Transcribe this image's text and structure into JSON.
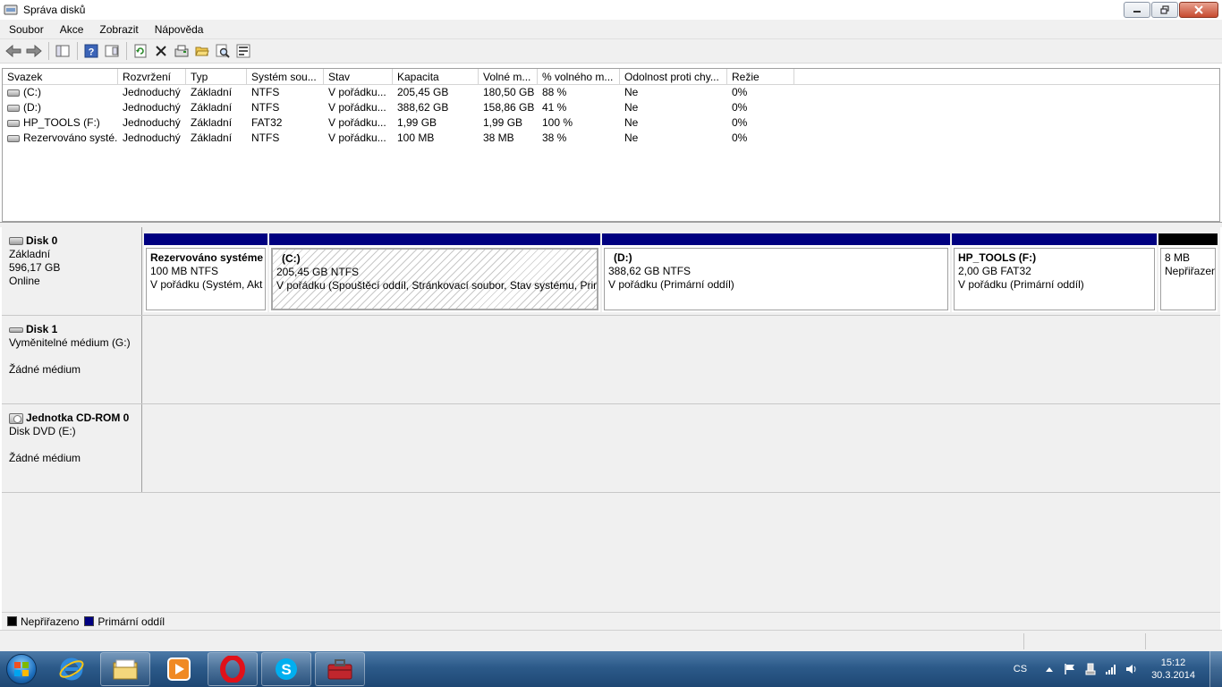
{
  "window": {
    "title": "Správa disků"
  },
  "menu": {
    "items": [
      "Soubor",
      "Akce",
      "Zobrazit",
      "Nápověda"
    ]
  },
  "toolbar": {
    "icons": [
      "back-icon",
      "forward-icon",
      "console-tree-icon",
      "help-icon",
      "properties-icon",
      "refresh-icon",
      "delete-icon",
      "rescan-icon",
      "open-icon",
      "search-icon",
      "settings-icon"
    ]
  },
  "volumes": {
    "columns": [
      "Svazek",
      "Rozvržení",
      "Typ",
      "Systém sou...",
      "Stav",
      "Kapacita",
      "Volné m...",
      "% volného m...",
      "Odolnost proti chy...",
      "Režie"
    ],
    "rows": [
      [
        "(C:)",
        "Jednoduchý",
        "Základní",
        "NTFS",
        "V pořádku...",
        "205,45 GB",
        "180,50 GB",
        "88 %",
        "Ne",
        "0%"
      ],
      [
        "(D:)",
        "Jednoduchý",
        "Základní",
        "NTFS",
        "V pořádku...",
        "388,62 GB",
        "158,86 GB",
        "41 %",
        "Ne",
        "0%"
      ],
      [
        "HP_TOOLS (F:)",
        "Jednoduchý",
        "Základní",
        "FAT32",
        "V pořádku...",
        "1,99 GB",
        "1,99 GB",
        "100 %",
        "Ne",
        "0%"
      ],
      [
        "Rezervováno systé...",
        "Jednoduchý",
        "Základní",
        "NTFS",
        "V pořádku...",
        "100 MB",
        "38 MB",
        "38 %",
        "Ne",
        "0%"
      ]
    ]
  },
  "disks": [
    {
      "name": "Disk 0",
      "type": "Základní",
      "size": "596,17 GB",
      "status": "Online",
      "partitions": [
        {
          "name": "Rezervováno systéme",
          "size": "100 MB NTFS",
          "status": "V pořádku (Systém, Akt"
        },
        {
          "name": "(C:)",
          "size": "205,45 GB NTFS",
          "status": "V pořádku (Spouštěcí oddíl, Stránkovací soubor, Stav systému, Prim"
        },
        {
          "name": "(D:)",
          "size": "388,62 GB NTFS",
          "status": "V pořádku (Primární oddíl)"
        },
        {
          "name": "HP_TOOLS  (F:)",
          "size": "2,00 GB FAT32",
          "status": "V pořádku (Primární oddíl)"
        },
        {
          "name": "",
          "size": "8 MB",
          "status": "Nepřiřazen"
        }
      ]
    },
    {
      "name": "Disk 1",
      "type": "Vyměnitelné médium (G:)",
      "status": "Žádné médium"
    },
    {
      "name": "Jednotka CD-ROM 0",
      "type": "Disk DVD (E:)",
      "status": "Žádné médium"
    }
  ],
  "legend": {
    "unallocated": "Nepřiřazeno",
    "primary": "Primární oddíl",
    "unallocated_color": "#000000",
    "primary_color": "#000080"
  },
  "taskbar": {
    "apps": [
      "internet-explorer-icon",
      "file-explorer-icon",
      "media-player-icon",
      "opera-icon",
      "skype-icon",
      "computer-management-icon"
    ],
    "language": "CS",
    "time": "15:12",
    "date": "30.3.2014"
  }
}
